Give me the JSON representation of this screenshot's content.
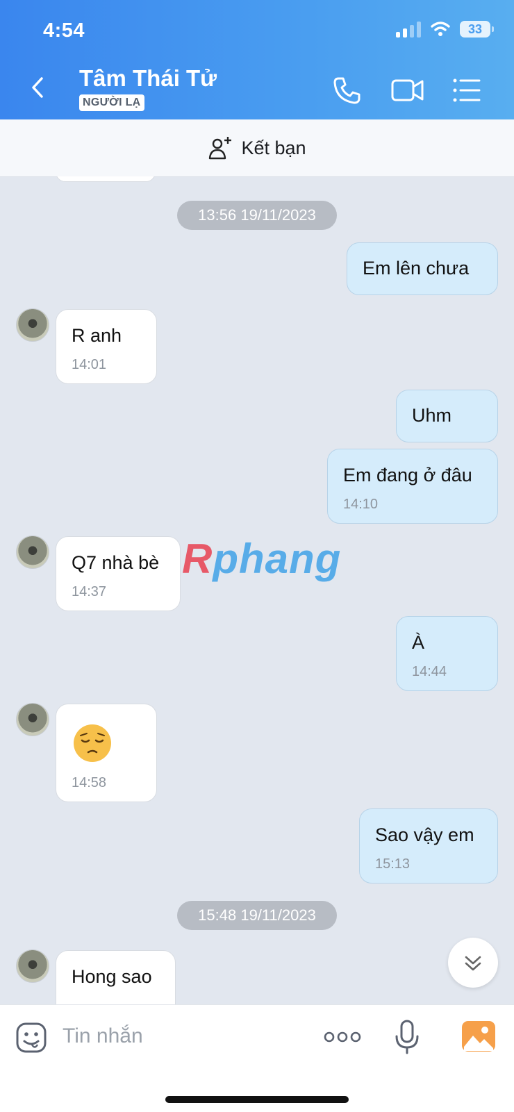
{
  "status": {
    "time": "4:54",
    "battery": "33"
  },
  "header": {
    "title": "Tâm Thái Tử",
    "badge": "NGƯỜI LẠ"
  },
  "friend_bar": {
    "label": "Kết bạn"
  },
  "dates": [
    "13:56 19/11/2023",
    "15:48 19/11/2023"
  ],
  "messages": [
    {
      "side": "out",
      "text": "Em lên chưa",
      "time": ""
    },
    {
      "side": "in",
      "text": "R anh",
      "time": "14:01"
    },
    {
      "side": "out",
      "text": "Uhm",
      "time": ""
    },
    {
      "side": "out",
      "text": "Em đang ở đâu",
      "time": "14:10"
    },
    {
      "side": "in",
      "text": "Q7 nhà bè",
      "time": "14:37"
    },
    {
      "side": "out",
      "text": "À",
      "time": "14:44"
    },
    {
      "side": "in",
      "text": "😔",
      "time": "14:58"
    },
    {
      "side": "out",
      "text": "Sao vậy em",
      "time": "15:13"
    },
    {
      "side": "in",
      "text": "Hong sao",
      "time": ""
    }
  ],
  "watermark": {
    "part1": "R",
    "part2": "phang"
  },
  "input": {
    "placeholder": "Tin nhắn"
  },
  "colors": {
    "header": "#4a9ef0",
    "outgoing_bubble": "#d5ecfb",
    "incoming_bubble": "#ffffff",
    "chat_bg": "#e2e7ef"
  }
}
